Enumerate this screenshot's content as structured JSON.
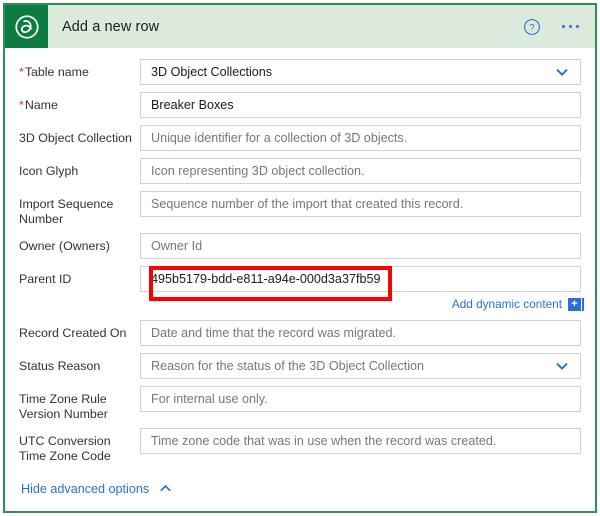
{
  "header": {
    "app_icon": "dataverse-logo-icon",
    "title": "Add a new row",
    "help_icon": "help-circle-icon",
    "more_icon": "ellipsis-icon"
  },
  "form": {
    "fields": [
      {
        "label": "Table name",
        "required": true,
        "value": "3D Object Collections",
        "placeholder": "",
        "control": "dropdown",
        "name": "table-name"
      },
      {
        "label": "Name",
        "required": true,
        "value": "Breaker Boxes",
        "placeholder": "",
        "control": "text",
        "name": "name"
      },
      {
        "label": "3D Object Collection",
        "required": false,
        "value": "",
        "placeholder": "Unique identifier for a collection of 3D objects.",
        "control": "text",
        "name": "3d-object-collection"
      },
      {
        "label": "Icon Glyph",
        "required": false,
        "value": "",
        "placeholder": "Icon representing 3D object collection.",
        "control": "text",
        "name": "icon-glyph"
      },
      {
        "label": "Import Sequence Number",
        "required": false,
        "value": "",
        "placeholder": "Sequence number of the import that created this record.",
        "control": "text",
        "name": "import-sequence-number"
      },
      {
        "label": "Owner (Owners)",
        "required": false,
        "value": "",
        "placeholder": "Owner Id",
        "control": "text",
        "name": "owner-owners"
      },
      {
        "label": "Parent ID",
        "required": false,
        "value": "495b5179-bdd-e811-a94e-000d3a37fb59",
        "placeholder": "",
        "control": "text",
        "name": "parent-id"
      },
      {
        "label": "Record Created On",
        "required": false,
        "value": "",
        "placeholder": "Date and time that the record was migrated.",
        "control": "text",
        "name": "record-created-on"
      },
      {
        "label": "Status Reason",
        "required": false,
        "value": "",
        "placeholder": "Reason for the status of the 3D Object Collection",
        "control": "dropdown",
        "name": "status-reason"
      },
      {
        "label": "Time Zone Rule Version Number",
        "required": false,
        "value": "",
        "placeholder": "For internal use only.",
        "control": "text",
        "name": "time-zone-rule-version-number"
      },
      {
        "label": "UTC Conversion Time Zone Code",
        "required": false,
        "value": "",
        "placeholder": "Time zone code that was in use when the record was created.",
        "control": "text",
        "name": "utc-conversion-time-zone-code"
      }
    ],
    "dynamic_content": {
      "label": "Add dynamic content",
      "badge": "+",
      "icon": "add-dynamic-content-icon"
    },
    "advanced_toggle": {
      "label": "Hide advanced options",
      "icon": "chevron-up-icon"
    }
  },
  "annotation": {
    "target_field": "parent-id",
    "color": "#fb0007"
  },
  "colors": {
    "frame_green": "#2f8f5b",
    "icon_tile_green": "#0e7c42",
    "header_bg": "#dce9dd",
    "link_blue": "#2b6fd4",
    "required_red": "#d13438",
    "annotation_red": "#fb0007"
  }
}
